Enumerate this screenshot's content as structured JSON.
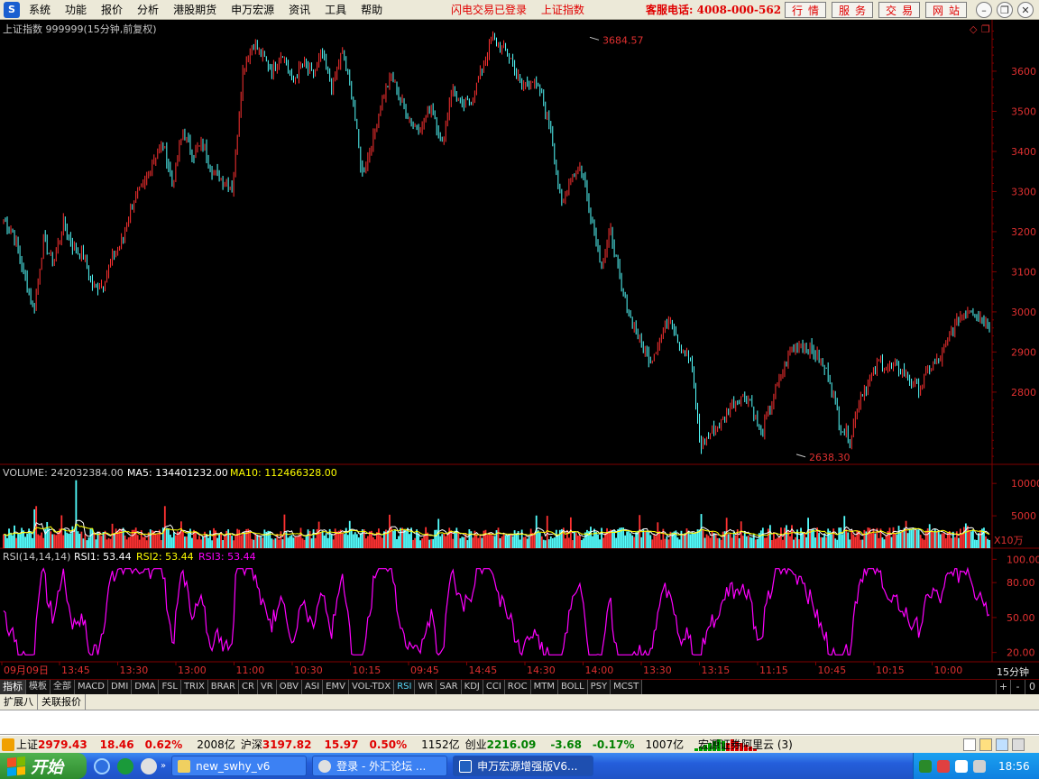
{
  "menu": {
    "items": [
      "系统",
      "功能",
      "报价",
      "分析",
      "港股期货",
      "申万宏源",
      "资讯",
      "工具",
      "帮助"
    ],
    "status1": "闪电交易已登录",
    "status2": "上证指数",
    "hotline": "客服电话: 4008-000-562",
    "buttons": [
      "行情",
      "服务",
      "交易",
      "网站"
    ]
  },
  "chart_header": {
    "title": "上证指数 999999(15分钟,前复权)",
    "volume_label": "VOLUME: 242032384.00",
    "ma5_label": "MA5: 134401232.00",
    "ma10_label": "MA10: 112466328.00",
    "rsi_label": "RSI(14,14,14)",
    "rsi1_label": "RSI1: 53.44",
    "rsi2_label": "RSI2: 53.44",
    "rsi3_label": "RSI3: 53.44",
    "unit_label": "X10万",
    "period_label": "15分钟"
  },
  "chart_data": {
    "type": "candlestick",
    "price_ticks": [
      2800,
      2900,
      3000,
      3100,
      3200,
      3300,
      3400,
      3500,
      3600
    ],
    "price_range": [
      2620,
      3710
    ],
    "max_label": "3684.57",
    "min_label": "2638.30",
    "max_value": 3684.57,
    "min_value": 2638.3,
    "price_path": [
      3230,
      3195,
      3100,
      3000,
      3180,
      3120,
      3220,
      3160,
      3140,
      3060,
      3070,
      3140,
      3180,
      3280,
      3310,
      3380,
      3420,
      3320,
      3450,
      3390,
      3420,
      3350,
      3330,
      3310,
      3600,
      3670,
      3640,
      3600,
      3650,
      3570,
      3620,
      3590,
      3640,
      3560,
      3650,
      3540,
      3340,
      3420,
      3530,
      3590,
      3520,
      3470,
      3460,
      3520,
      3410,
      3560,
      3510,
      3530,
      3600,
      3680,
      3660,
      3630,
      3560,
      3580,
      3540,
      3450,
      3260,
      3340,
      3360,
      3240,
      3120,
      3200,
      3060,
      2980,
      2920,
      2880,
      2940,
      2990,
      2910,
      2880,
      2660,
      2700,
      2720,
      2770,
      2790,
      2780,
      2690,
      2760,
      2840,
      2900,
      2920,
      2910,
      2880,
      2830,
      2720,
      2680,
      2790,
      2830,
      2880,
      2860,
      2860,
      2830,
      2810,
      2860,
      2880,
      2940,
      2990,
      3010,
      2990,
      2970
    ],
    "volume_ticks": [
      5000,
      10000
    ],
    "volume_range": [
      0,
      11000
    ],
    "volume_spikes": [
      {
        "i": 40,
        "v": 10500
      },
      {
        "i": 18,
        "v": 6500
      },
      {
        "i": 17,
        "v": 6000
      },
      {
        "i": 89,
        "v": 6500
      },
      {
        "i": 155,
        "v": 5200
      },
      {
        "i": 300,
        "v": 5000
      }
    ],
    "rsi_ticks": [
      20.0,
      50.0,
      80.0,
      100.0
    ],
    "rsi_range": [
      12,
      108
    ],
    "time_labels": [
      "09月09日",
      "13:45",
      "13:30",
      "13:00",
      "11:00",
      "10:30",
      "10:15",
      "09:45",
      "14:45",
      "14:30",
      "14:00",
      "13:30",
      "13:15",
      "11:15",
      "10:45",
      "10:15",
      "10:00"
    ]
  },
  "indicator_tabs": [
    "指标",
    "模板",
    "全部",
    "MACD",
    "DMI",
    "DMA",
    "FSL",
    "TRIX",
    "BRAR",
    "CR",
    "VR",
    "OBV",
    "ASI",
    "EMV",
    "VOL-TDX",
    "RSI",
    "WR",
    "SAR",
    "KDJ",
    "CCI",
    "ROC",
    "MTM",
    "BOLL",
    "PSY",
    "MCST"
  ],
  "indicator_active": "RSI",
  "indicator_controls": [
    "+",
    "-",
    "0"
  ],
  "ext_tabs": [
    "扩展八",
    "关联报价"
  ],
  "statusbar": {
    "sh_name": "上证",
    "sh_price": "2979.43",
    "sh_chg": "18.46",
    "sh_pct": "0.62%",
    "sh_amt": "2008亿",
    "hs_name": "沪深",
    "hs_price": "3197.82",
    "hs_chg": "15.97",
    "hs_pct": "0.50%",
    "hs_amt": "1152亿",
    "cy_name": "创业",
    "cy_price": "2216.09",
    "cy_chg": "-3.68",
    "cy_pct": "-0.17%",
    "cy_amt": "1007亿",
    "broker": "宏源证券阿里云 (3)"
  },
  "taskbar": {
    "start": "开始",
    "tasks": [
      "new_swhy_v6",
      "登录 - 外汇论坛 ...",
      "申万宏源增强版V6..."
    ],
    "clock": "18:56"
  },
  "colors": {
    "up": "#ff3232",
    "down": "#54ffff",
    "grid": "#800000",
    "rsi": "#ff00ff",
    "ma5": "#ffffff",
    "ma10": "#ffff00"
  }
}
